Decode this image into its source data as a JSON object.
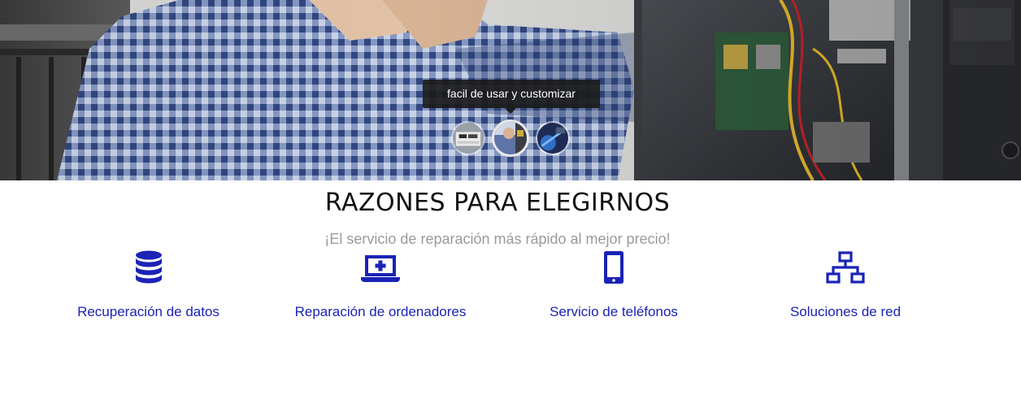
{
  "hero": {
    "tooltip_text": "facil de usar y customizar",
    "thumbnails": [
      {
        "label": "slide-thumbnail-1",
        "active": false
      },
      {
        "label": "slide-thumbnail-2",
        "active": true
      },
      {
        "label": "slide-thumbnail-3",
        "active": false
      }
    ]
  },
  "reasons": {
    "title": "RAZONES PARA ELEGIRNOS",
    "subtitle": "¡El servicio de reparación más rápido al mejor precio!",
    "features": [
      {
        "icon": "database-icon",
        "label": "Recuperación de datos"
      },
      {
        "icon": "laptop-plus-icon",
        "label": "Reparación de ordenadores"
      },
      {
        "icon": "mobile-phone-icon",
        "label": "Servicio de teléfonos"
      },
      {
        "icon": "network-icon",
        "label": "Soluciones de red"
      }
    ]
  },
  "colors": {
    "accent": "#1a23b5",
    "title": "#111111",
    "subtitle": "#9a9a9a",
    "tooltip_bg": "#1a1a1a"
  }
}
